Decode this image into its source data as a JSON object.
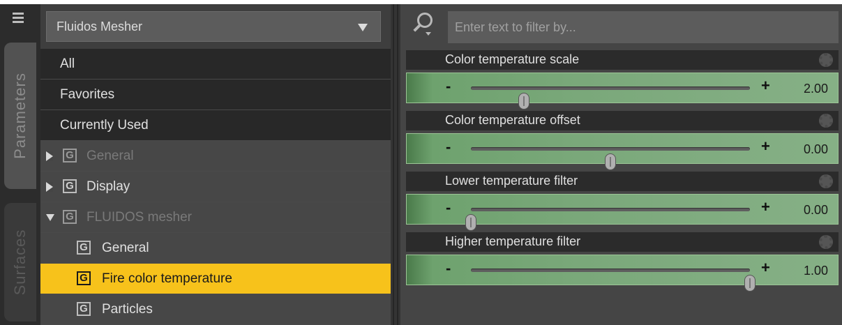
{
  "side_tabs": [
    {
      "label": "Parameters",
      "active": true
    },
    {
      "label": "Surfaces",
      "active": false
    }
  ],
  "left_panel": {
    "dropdown": {
      "value": "Fluidos Mesher"
    },
    "plain_items": [
      "All",
      "Favorites",
      "Currently Used"
    ],
    "groups": [
      {
        "label": "General",
        "icon": "G",
        "expand": "collapsed",
        "dimmed": true
      },
      {
        "label": "Display",
        "icon": "G",
        "expand": "collapsed",
        "dimmed": false
      },
      {
        "label": "FLUIDOS mesher",
        "icon": "G",
        "expand": "expanded",
        "dimmed": true
      }
    ],
    "sub_items": [
      {
        "label": "General",
        "icon": "G",
        "selected": false
      },
      {
        "label": "Fire color temperature",
        "icon": "G",
        "selected": true
      },
      {
        "label": "Particles",
        "icon": "G",
        "selected": false
      }
    ]
  },
  "right_panel": {
    "search": {
      "placeholder": "Enter text to filter by..."
    },
    "params": [
      {
        "name": "Color temperature scale",
        "value": "2.00",
        "fraction": 0.19
      },
      {
        "name": "Color temperature offset",
        "value": "0.00",
        "fraction": 0.5
      },
      {
        "name": "Lower temperature filter",
        "value": "0.00",
        "fraction": 0.0
      },
      {
        "name": "Higher temperature filter",
        "value": "1.00",
        "fraction": 1.0
      }
    ]
  },
  "colors": {
    "selection": "#f7c21b",
    "slider_fill": "#7aa87a",
    "panel_bg": "#3e3e3e"
  }
}
